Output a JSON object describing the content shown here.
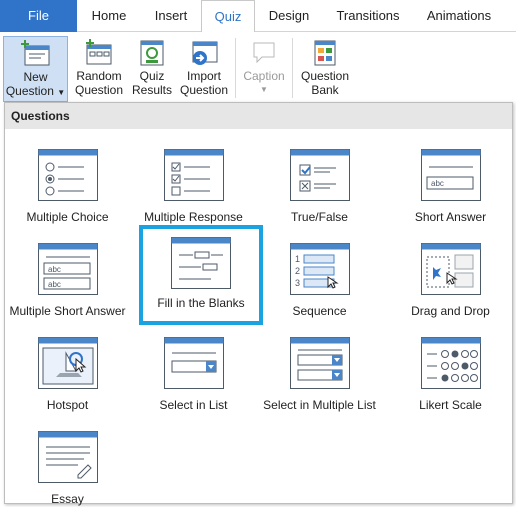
{
  "tabs": [
    {
      "label": "File"
    },
    {
      "label": "Home"
    },
    {
      "label": "Insert"
    },
    {
      "label": "Quiz"
    },
    {
      "label": "Design"
    },
    {
      "label": "Transitions"
    },
    {
      "label": "Animations"
    }
  ],
  "active_tab": "Quiz",
  "ribbon": {
    "new_question": {
      "line1": "New",
      "line2": "Question"
    },
    "random_question": {
      "line1": "Random",
      "line2": "Question"
    },
    "quiz_results": {
      "line1": "Quiz",
      "line2": "Results"
    },
    "import_question": {
      "line1": "Import",
      "line2": "Question"
    },
    "caption": {
      "line1": "Caption"
    },
    "question_bank": {
      "line1": "Question",
      "line2": "Bank"
    }
  },
  "panel": {
    "header": "Questions",
    "items": [
      {
        "label": "Multiple Choice",
        "icon": "multiple-choice-icon"
      },
      {
        "label": "Multiple Response",
        "icon": "multiple-response-icon"
      },
      {
        "label": "True/False",
        "icon": "true-false-icon"
      },
      {
        "label": "Short Answer",
        "icon": "short-answer-icon"
      },
      {
        "label": "Multiple Short Answer",
        "icon": "multiple-short-answer-icon"
      },
      {
        "label": "Fill in the Blanks",
        "icon": "fill-in-the-blanks-icon"
      },
      {
        "label": "Sequence",
        "icon": "sequence-icon"
      },
      {
        "label": "Drag and Drop",
        "icon": "drag-and-drop-icon"
      },
      {
        "label": "Hotspot",
        "icon": "hotspot-icon"
      },
      {
        "label": "Select in List",
        "icon": "select-in-list-icon"
      },
      {
        "label": "Select in Multiple List",
        "icon": "select-in-multiple-list-icon"
      },
      {
        "label": "Likert Scale",
        "icon": "likert-scale-icon"
      },
      {
        "label": "Essay",
        "icon": "essay-icon"
      }
    ],
    "highlighted_item": "Fill in the Blanks",
    "highlight_color": "#1aa3e0"
  },
  "colors": {
    "file_tab": "#2f74c9",
    "selected_button": "#cfe0f4",
    "icon_blue": "#4a86c8",
    "icon_stroke": "#4d5a68"
  },
  "sample_text": {
    "abc": "abc",
    "seq1": "1",
    "seq2": "2",
    "seq3": "3"
  }
}
